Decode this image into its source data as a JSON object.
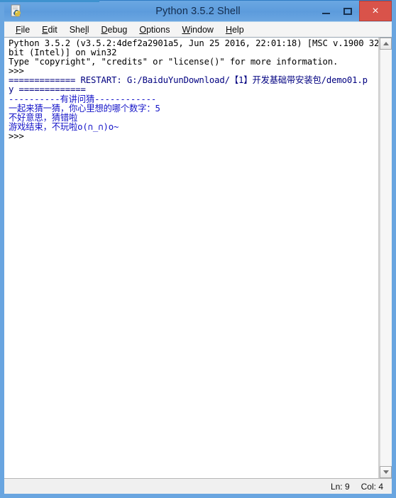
{
  "window": {
    "title": "Python 3.5.2 Shell",
    "app_icon": "python-idle-icon",
    "controls": {
      "minimize_label": "–",
      "maximize_label": "□",
      "close_label": "×"
    },
    "accent_close_color": "#d9534a",
    "titlebar_color": "#5e9ddd",
    "frame_color": "#69a5e0"
  },
  "menubar": {
    "items": [
      {
        "label": "File",
        "accel": "F"
      },
      {
        "label": "Edit",
        "accel": "E"
      },
      {
        "label": "Shell",
        "accel": "l"
      },
      {
        "label": "Debug",
        "accel": "D"
      },
      {
        "label": "Options",
        "accel": "O"
      },
      {
        "label": "Window",
        "accel": "W"
      },
      {
        "label": "Help",
        "accel": "H"
      }
    ]
  },
  "shell": {
    "lines": [
      {
        "text": "Python 3.5.2 (v3.5.2:4def2a2901a5, Jun 25 2016, 22:01:18) [MSC v.1900 32",
        "color": "black"
      },
      {
        "text": "bit (Intel)] on win32",
        "color": "black"
      },
      {
        "text": "Type \"copyright\", \"credits\" or \"license()\" for more information.",
        "color": "black"
      },
      {
        "text": ">>>",
        "color": "black"
      },
      {
        "text": "============= RESTART: G:/BaiduYunDownload/【1】开发基础带安装包/demo01.p",
        "color": "restart"
      },
      {
        "text": "y =============",
        "color": "restart"
      },
      {
        "text": "----------有讲问猜------------",
        "color": "blue"
      },
      {
        "text": "一起来猜一猜，你心里想的哪个数字：5",
        "color": "blue"
      },
      {
        "text": "不好意思，猜错啦",
        "color": "blue"
      },
      {
        "text": "游戏结束，不玩啦o(∩_∩)o~",
        "color": "blue"
      },
      {
        "text": ">>>",
        "color": "black"
      }
    ]
  },
  "scrollbar": {
    "up_arrow_icon": "scroll-up-arrow-icon",
    "down_arrow_icon": "scroll-down-arrow-icon"
  },
  "statusbar": {
    "line_label": "Ln: 9",
    "col_label": "Col: 4"
  }
}
